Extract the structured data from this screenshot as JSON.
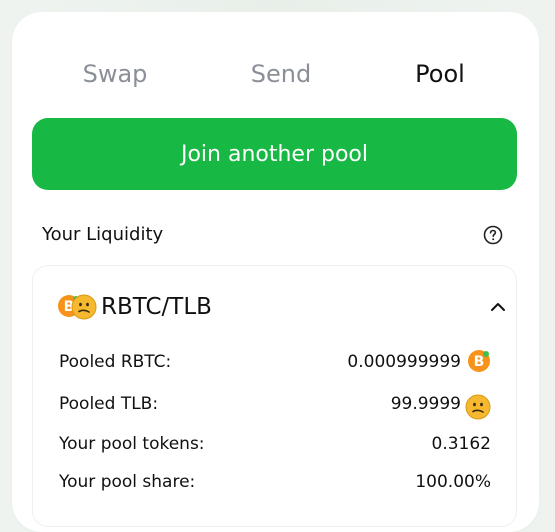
{
  "tabs": [
    {
      "label": "Swap",
      "active": false
    },
    {
      "label": "Send",
      "active": false
    },
    {
      "label": "Pool",
      "active": true
    }
  ],
  "join_button": {
    "label": "Join another pool"
  },
  "liquidity": {
    "title": "Your Liquidity",
    "help_icon": "question-circle-icon"
  },
  "pool": {
    "pair": "RBTC/TLB",
    "token_a_icon": "rbtc-token-icon",
    "token_b_icon": "tlb-token-icon",
    "expand_icon": "chevron-up-icon",
    "rows": [
      {
        "label": "Pooled RBTC:",
        "value": "0.000999999",
        "icon": "rbtc-token-icon"
      },
      {
        "label": "Pooled TLB:",
        "value": "99.9999",
        "icon": "tlb-token-icon"
      },
      {
        "label": "Your pool tokens:",
        "value": "0.3162"
      },
      {
        "label": "Your pool share:",
        "value": "100.00%"
      }
    ]
  },
  "colors": {
    "accent_green": "#17b844",
    "btc_orange": "#f7931a",
    "tlb_yellow": "#f5b82e",
    "inactive_tab": "#8a8f98"
  }
}
